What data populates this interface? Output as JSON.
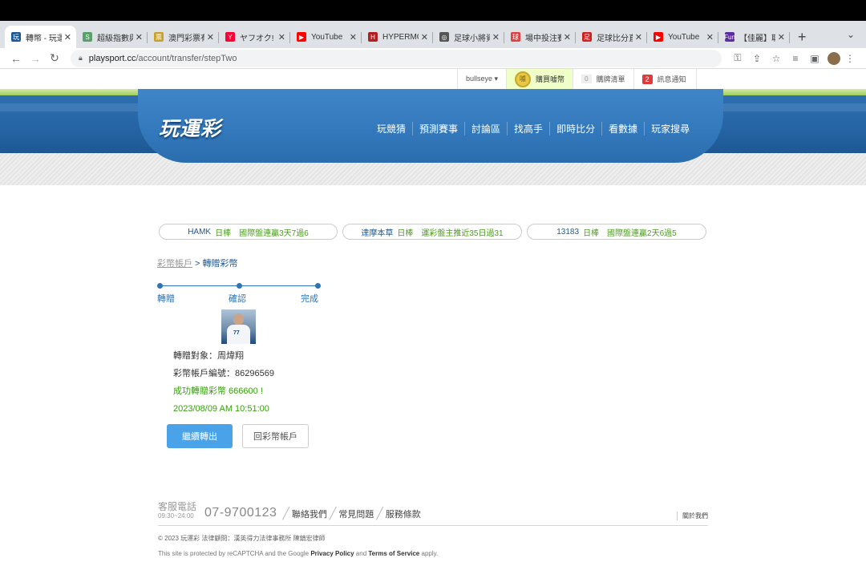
{
  "browser": {
    "tabs": [
      {
        "title": "轉幣 - 玩運",
        "favicon_color": "#1d5894",
        "favicon_text": "玩",
        "active": true
      },
      {
        "title": "超級指數與",
        "favicon_color": "#5aa06a",
        "favicon_text": "S",
        "active": false
      },
      {
        "title": "澳門彩票有",
        "favicon_color": "#c8a030",
        "favicon_text": "票",
        "active": false
      },
      {
        "title": "ヤフオク!",
        "favicon_color": "#ff0033",
        "favicon_text": "Y",
        "active": false
      },
      {
        "title": "YouTube",
        "favicon_color": "#ff0000",
        "favicon_text": "▶",
        "active": false
      },
      {
        "title": "HYPERMO",
        "favicon_color": "#b02020",
        "favicon_text": "H",
        "active": false
      },
      {
        "title": "足球小將資",
        "favicon_color": "#555555",
        "favicon_text": "◎",
        "active": false
      },
      {
        "title": "場中投注賽",
        "favicon_color": "#e04040",
        "favicon_text": "球",
        "active": false
      },
      {
        "title": "足球比分直",
        "favicon_color": "#d02020",
        "favicon_text": "足",
        "active": false
      },
      {
        "title": "YouTube",
        "favicon_color": "#ff0000",
        "favicon_text": "▶",
        "active": false
      },
      {
        "title": "【佳麗】取",
        "favicon_color": "#5a2ea0",
        "favicon_text": "Fun",
        "active": false
      }
    ],
    "close_glyph": "✕",
    "new_tab_glyph": "+",
    "tab_menu_glyph": "⌄",
    "url_host": "playsport.cc",
    "url_path": "/account/transfer/stepTwo",
    "icons": [
      "back-icon",
      "forward-icon",
      "reload-icon",
      "key-icon",
      "share-icon",
      "bookmark-star-icon",
      "reading-list-icon",
      "side-panel-icon",
      "profile-avatar"
    ]
  },
  "member_bar": {
    "username": "bullseye ▾",
    "buy_label": "購買噱幣",
    "cart_count": "0",
    "cart_label": "購牌清單",
    "notify_count": "2",
    "notify_label": "訊息通知"
  },
  "header": {
    "logo": "玩運彩",
    "nav": [
      "玩競猜",
      "預測賽事",
      "討論區",
      "找高手",
      "即時比分",
      "看數據",
      "玩家搜尋"
    ]
  },
  "ticker": [
    {
      "name": "HAMK",
      "rest": "日棒　國際盤連贏3天7過6"
    },
    {
      "name": "達摩本草",
      "rest": "日棒　運彩盤主推近35日過31"
    },
    {
      "name": "13183",
      "rest": "日棒　國際盤連贏2天6過5"
    }
  ],
  "breadcrumb": {
    "parent": "彩幣帳戶",
    "separator": " > ",
    "current": "轉贈彩幣"
  },
  "steps": [
    "轉贈",
    "確認",
    "完成"
  ],
  "transfer": {
    "recipient": "轉贈對象：周煒翔",
    "account_no": "彩幣帳戶編號：86296569",
    "success": "成功轉贈彩幣 666600 !",
    "timestamp": "2023/08/09 AM 10:51:00",
    "avatar_jersey": "77"
  },
  "buttons": {
    "continue": "繼續轉出",
    "back": "回彩幣帳戶"
  },
  "footer": {
    "service_label": "客服電話",
    "service_hours": "09:30~24:00",
    "phone": "07-9700123",
    "links": [
      "聯絡我們",
      "常見問題",
      "服務條款"
    ],
    "about": "關於我們",
    "copyright": "© 2023 玩運彩 法律顧問：漢英得力法律事務所 陳鎮宏律師",
    "captcha_prefix": "This site is protected by reCAPTCHA and the Google ",
    "captcha_privacy": "Privacy Policy",
    "captcha_and": " and ",
    "captcha_terms": "Terms of Service",
    "captcha_suffix": " apply."
  }
}
